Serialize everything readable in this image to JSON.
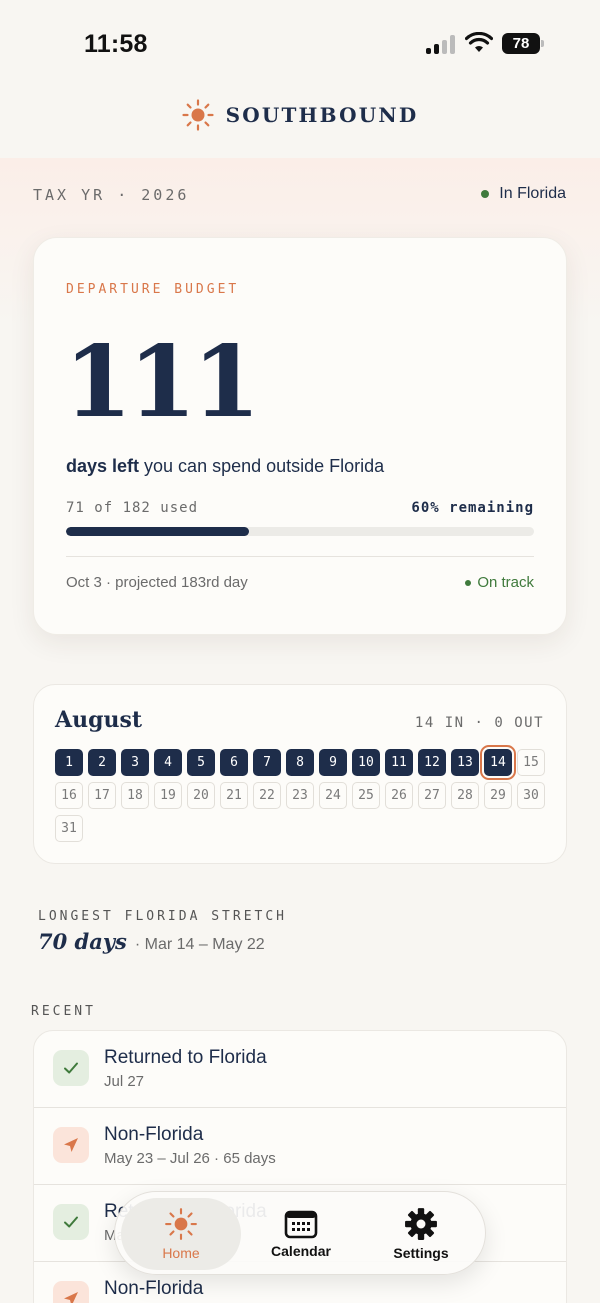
{
  "status_bar": {
    "time": "11:58",
    "battery": "78"
  },
  "header": {
    "brand": "SOUTHBOUND",
    "icon": "sun-icon"
  },
  "tax_year": "TAX YR · 2026",
  "location_status": "In Florida",
  "budget": {
    "label": "DEPARTURE BUDGET",
    "days_left": "111",
    "days_left_bold": "days left",
    "days_left_rest": " you can spend outside Florida",
    "used_text": "71 of 182 used",
    "remaining_text": "60% remaining",
    "progress_fraction": 0.39,
    "projection": "Oct 3 · projected 183rd day",
    "status": "On track"
  },
  "calendar": {
    "month": "August",
    "stats": "14 IN · 0 OUT",
    "days": [
      "1",
      "2",
      "3",
      "4",
      "5",
      "6",
      "7",
      "8",
      "9",
      "10",
      "11",
      "12",
      "13",
      "14",
      "15",
      "16",
      "17",
      "18",
      "19",
      "20",
      "21",
      "22",
      "23",
      "24",
      "25",
      "26",
      "27",
      "28",
      "29",
      "30",
      "31"
    ],
    "days_in_florida": 14,
    "today": "14"
  },
  "stretch": {
    "label": "LONGEST FLORIDA STRETCH",
    "value": "70 days",
    "range": "· Mar 14 – May 22"
  },
  "recent": {
    "label": "RECENT",
    "items": [
      {
        "title": "Returned to Florida",
        "subtitle": "Jul 27",
        "icon": "check-icon"
      },
      {
        "title": "Non-Florida",
        "subtitle": "May 23 – Jul 26 · 65 days",
        "icon": "plane-icon"
      },
      {
        "title": "Returned to Florida",
        "subtitle": "May 22",
        "icon": "check-icon"
      },
      {
        "title": "Non-Florida",
        "subtitle": "",
        "icon": "plane-icon"
      }
    ]
  },
  "tabs": [
    {
      "label": "Home",
      "icon": "sun-icon"
    },
    {
      "label": "Calendar",
      "icon": "calendar-icon"
    },
    {
      "label": "Settings",
      "icon": "gear-icon"
    }
  ],
  "colors": {
    "navy": "#1e2d4a",
    "accent": "#d9774a",
    "green": "#3f7a3c",
    "background": "#f8f6f2"
  }
}
